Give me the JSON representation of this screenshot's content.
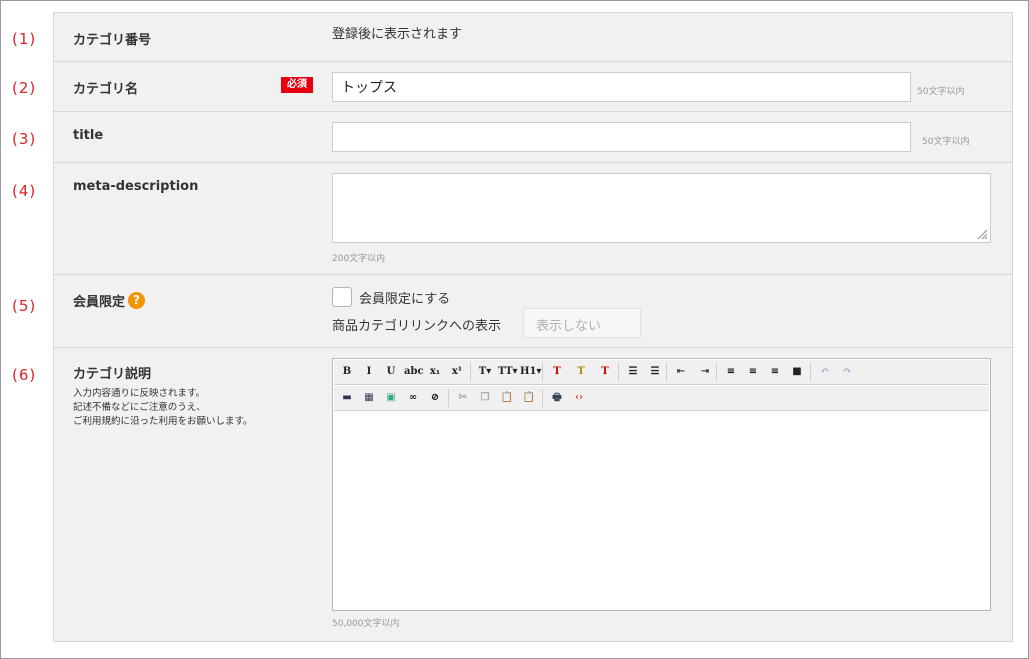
{
  "numbers": [
    "(1)",
    "(2)",
    "(3)",
    "(4)",
    "(5)",
    "(6)"
  ],
  "category_number": {
    "label": "カテゴリ番号",
    "value": "登録後に表示されます"
  },
  "category_name": {
    "label": "カテゴリ名",
    "required": "必須",
    "value": "トップス",
    "limit": "50文字以内"
  },
  "title": {
    "label": "title",
    "value": "",
    "limit": "50文字以内"
  },
  "meta_description": {
    "label": "meta-description",
    "value": "",
    "limit": "200文字以内"
  },
  "members_only": {
    "label": "会員限定",
    "help": "?",
    "checkbox_label": "会員限定にする",
    "link_label": "商品カテゴリリンクへの表示",
    "select_value": "表示しない"
  },
  "category_description": {
    "label": "カテゴリ説明",
    "note": [
      "入力内容通りに反映されます。",
      "記述不備などにご注意のうえ、",
      "ご利用規約に沿った利用をお願いします。"
    ],
    "limit": "50,000文字以内"
  },
  "toolbar1": [
    {
      "name": "bold-button",
      "glyph": "B"
    },
    {
      "name": "italic-button",
      "glyph": "I"
    },
    {
      "name": "underline-button",
      "glyph": "U"
    },
    {
      "name": "strikethrough-button",
      "glyph": "abc"
    },
    {
      "name": "subscript-button",
      "glyph": "x₁"
    },
    {
      "name": "superscript-button",
      "glyph": "x¹"
    },
    {
      "name": "font-size-button",
      "glyph": "T▾"
    },
    {
      "name": "font-family-button",
      "glyph": "TT▾"
    },
    {
      "name": "heading-button",
      "glyph": "H1▾"
    },
    {
      "name": "text-color-button",
      "glyph": "T"
    },
    {
      "name": "highlight-button",
      "glyph": "T"
    },
    {
      "name": "remove-format-button",
      "glyph": "T"
    },
    {
      "name": "bulleted-list-button",
      "glyph": "☰"
    },
    {
      "name": "numbered-list-button",
      "glyph": "☰"
    },
    {
      "name": "outdent-button",
      "glyph": "⇤"
    },
    {
      "name": "indent-button",
      "glyph": "⇥"
    },
    {
      "name": "align-left-button",
      "glyph": "≡"
    },
    {
      "name": "align-center-button",
      "glyph": "≡"
    },
    {
      "name": "align-right-button",
      "glyph": "≡"
    },
    {
      "name": "align-justify-button",
      "glyph": "■"
    },
    {
      "name": "undo-button",
      "glyph": "↶"
    },
    {
      "name": "redo-button",
      "glyph": "↷"
    }
  ],
  "toolbar2": [
    {
      "name": "horizontal-rule-button",
      "glyph": "▬"
    },
    {
      "name": "table-button",
      "glyph": "▦"
    },
    {
      "name": "image-button",
      "glyph": "▣"
    },
    {
      "name": "link-button",
      "glyph": "∞"
    },
    {
      "name": "unlink-button",
      "glyph": "⊘"
    },
    {
      "name": "cut-button",
      "glyph": "✂"
    },
    {
      "name": "copy-button",
      "glyph": "❐"
    },
    {
      "name": "paste-button",
      "glyph": "📋"
    },
    {
      "name": "paste-text-button",
      "glyph": "📋"
    },
    {
      "name": "print-button",
      "glyph": "🖶"
    },
    {
      "name": "source-button",
      "glyph": "‹›"
    }
  ],
  "colors": {
    "accent_red": "#d9232a",
    "required_red": "#e60012",
    "help_orange": "#f29600",
    "panel_bg": "#f1f1f1"
  }
}
